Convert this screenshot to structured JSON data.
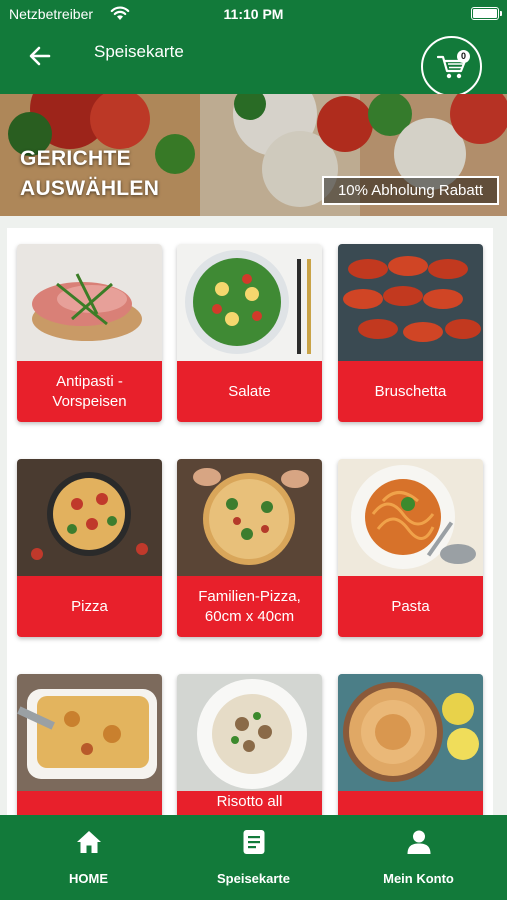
{
  "status_bar": {
    "carrier": "Netzbetreiber",
    "time": "11:10 PM"
  },
  "header": {
    "title": "Speisekarte",
    "cart_count": "0"
  },
  "banner": {
    "title_line1": "GERICHTE",
    "title_line2": "AUSWÄHLEN",
    "badge": "10% Abholung Rabatt"
  },
  "categories": [
    {
      "label": "Antipasti - Vorspeisen"
    },
    {
      "label": "Salate"
    },
    {
      "label": "Bruschetta"
    },
    {
      "label": "Pizza"
    },
    {
      "label": "Familien-Pizza, 60cm x 40cm"
    },
    {
      "label": "Pasta"
    },
    {
      "label": ""
    },
    {
      "label": "Risotto all"
    },
    {
      "label": ""
    }
  ],
  "bottom_nav": [
    {
      "label": "HOME",
      "icon": "home-icon"
    },
    {
      "label": "Speisekarte",
      "icon": "menu-list-icon"
    },
    {
      "label": "Mein Konto",
      "icon": "user-icon"
    }
  ],
  "colors": {
    "brand_green": "#127a3a",
    "card_red": "#e8202b"
  }
}
